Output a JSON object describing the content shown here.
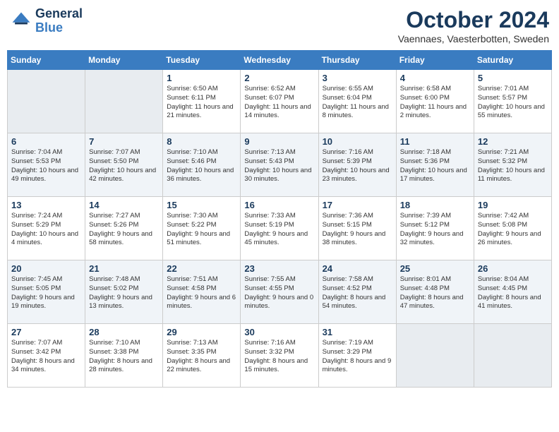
{
  "logo": {
    "text_general": "General",
    "text_blue": "Blue"
  },
  "header": {
    "title": "October 2024",
    "subtitle": "Vaennaes, Vaesterbotten, Sweden"
  },
  "weekdays": [
    "Sunday",
    "Monday",
    "Tuesday",
    "Wednesday",
    "Thursday",
    "Friday",
    "Saturday"
  ],
  "weeks": [
    [
      {
        "day": "",
        "sunrise": "",
        "sunset": "",
        "daylight": ""
      },
      {
        "day": "",
        "sunrise": "",
        "sunset": "",
        "daylight": ""
      },
      {
        "day": "1",
        "sunrise": "Sunrise: 6:50 AM",
        "sunset": "Sunset: 6:11 PM",
        "daylight": "Daylight: 11 hours and 21 minutes."
      },
      {
        "day": "2",
        "sunrise": "Sunrise: 6:52 AM",
        "sunset": "Sunset: 6:07 PM",
        "daylight": "Daylight: 11 hours and 14 minutes."
      },
      {
        "day": "3",
        "sunrise": "Sunrise: 6:55 AM",
        "sunset": "Sunset: 6:04 PM",
        "daylight": "Daylight: 11 hours and 8 minutes."
      },
      {
        "day": "4",
        "sunrise": "Sunrise: 6:58 AM",
        "sunset": "Sunset: 6:00 PM",
        "daylight": "Daylight: 11 hours and 2 minutes."
      },
      {
        "day": "5",
        "sunrise": "Sunrise: 7:01 AM",
        "sunset": "Sunset: 5:57 PM",
        "daylight": "Daylight: 10 hours and 55 minutes."
      }
    ],
    [
      {
        "day": "6",
        "sunrise": "Sunrise: 7:04 AM",
        "sunset": "Sunset: 5:53 PM",
        "daylight": "Daylight: 10 hours and 49 minutes."
      },
      {
        "day": "7",
        "sunrise": "Sunrise: 7:07 AM",
        "sunset": "Sunset: 5:50 PM",
        "daylight": "Daylight: 10 hours and 42 minutes."
      },
      {
        "day": "8",
        "sunrise": "Sunrise: 7:10 AM",
        "sunset": "Sunset: 5:46 PM",
        "daylight": "Daylight: 10 hours and 36 minutes."
      },
      {
        "day": "9",
        "sunrise": "Sunrise: 7:13 AM",
        "sunset": "Sunset: 5:43 PM",
        "daylight": "Daylight: 10 hours and 30 minutes."
      },
      {
        "day": "10",
        "sunrise": "Sunrise: 7:16 AM",
        "sunset": "Sunset: 5:39 PM",
        "daylight": "Daylight: 10 hours and 23 minutes."
      },
      {
        "day": "11",
        "sunrise": "Sunrise: 7:18 AM",
        "sunset": "Sunset: 5:36 PM",
        "daylight": "Daylight: 10 hours and 17 minutes."
      },
      {
        "day": "12",
        "sunrise": "Sunrise: 7:21 AM",
        "sunset": "Sunset: 5:32 PM",
        "daylight": "Daylight: 10 hours and 11 minutes."
      }
    ],
    [
      {
        "day": "13",
        "sunrise": "Sunrise: 7:24 AM",
        "sunset": "Sunset: 5:29 PM",
        "daylight": "Daylight: 10 hours and 4 minutes."
      },
      {
        "day": "14",
        "sunrise": "Sunrise: 7:27 AM",
        "sunset": "Sunset: 5:26 PM",
        "daylight": "Daylight: 9 hours and 58 minutes."
      },
      {
        "day": "15",
        "sunrise": "Sunrise: 7:30 AM",
        "sunset": "Sunset: 5:22 PM",
        "daylight": "Daylight: 9 hours and 51 minutes."
      },
      {
        "day": "16",
        "sunrise": "Sunrise: 7:33 AM",
        "sunset": "Sunset: 5:19 PM",
        "daylight": "Daylight: 9 hours and 45 minutes."
      },
      {
        "day": "17",
        "sunrise": "Sunrise: 7:36 AM",
        "sunset": "Sunset: 5:15 PM",
        "daylight": "Daylight: 9 hours and 38 minutes."
      },
      {
        "day": "18",
        "sunrise": "Sunrise: 7:39 AM",
        "sunset": "Sunset: 5:12 PM",
        "daylight": "Daylight: 9 hours and 32 minutes."
      },
      {
        "day": "19",
        "sunrise": "Sunrise: 7:42 AM",
        "sunset": "Sunset: 5:08 PM",
        "daylight": "Daylight: 9 hours and 26 minutes."
      }
    ],
    [
      {
        "day": "20",
        "sunrise": "Sunrise: 7:45 AM",
        "sunset": "Sunset: 5:05 PM",
        "daylight": "Daylight: 9 hours and 19 minutes."
      },
      {
        "day": "21",
        "sunrise": "Sunrise: 7:48 AM",
        "sunset": "Sunset: 5:02 PM",
        "daylight": "Daylight: 9 hours and 13 minutes."
      },
      {
        "day": "22",
        "sunrise": "Sunrise: 7:51 AM",
        "sunset": "Sunset: 4:58 PM",
        "daylight": "Daylight: 9 hours and 6 minutes."
      },
      {
        "day": "23",
        "sunrise": "Sunrise: 7:55 AM",
        "sunset": "Sunset: 4:55 PM",
        "daylight": "Daylight: 9 hours and 0 minutes."
      },
      {
        "day": "24",
        "sunrise": "Sunrise: 7:58 AM",
        "sunset": "Sunset: 4:52 PM",
        "daylight": "Daylight: 8 hours and 54 minutes."
      },
      {
        "day": "25",
        "sunrise": "Sunrise: 8:01 AM",
        "sunset": "Sunset: 4:48 PM",
        "daylight": "Daylight: 8 hours and 47 minutes."
      },
      {
        "day": "26",
        "sunrise": "Sunrise: 8:04 AM",
        "sunset": "Sunset: 4:45 PM",
        "daylight": "Daylight: 8 hours and 41 minutes."
      }
    ],
    [
      {
        "day": "27",
        "sunrise": "Sunrise: 7:07 AM",
        "sunset": "Sunset: 3:42 PM",
        "daylight": "Daylight: 8 hours and 34 minutes."
      },
      {
        "day": "28",
        "sunrise": "Sunrise: 7:10 AM",
        "sunset": "Sunset: 3:38 PM",
        "daylight": "Daylight: 8 hours and 28 minutes."
      },
      {
        "day": "29",
        "sunrise": "Sunrise: 7:13 AM",
        "sunset": "Sunset: 3:35 PM",
        "daylight": "Daylight: 8 hours and 22 minutes."
      },
      {
        "day": "30",
        "sunrise": "Sunrise: 7:16 AM",
        "sunset": "Sunset: 3:32 PM",
        "daylight": "Daylight: 8 hours and 15 minutes."
      },
      {
        "day": "31",
        "sunrise": "Sunrise: 7:19 AM",
        "sunset": "Sunset: 3:29 PM",
        "daylight": "Daylight: 8 hours and 9 minutes."
      },
      {
        "day": "",
        "sunrise": "",
        "sunset": "",
        "daylight": ""
      },
      {
        "day": "",
        "sunrise": "",
        "sunset": "",
        "daylight": ""
      }
    ]
  ]
}
